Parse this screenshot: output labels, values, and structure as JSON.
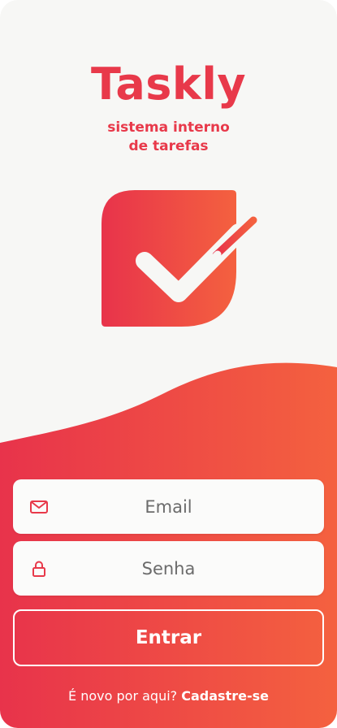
{
  "app": {
    "name": "Taskly",
    "tagline_line1": "sistema interno",
    "tagline_line2": "de tarefas"
  },
  "colors": {
    "brand_red": "#e8394a",
    "brand_orange": "#f4613f",
    "background": "#f7f7f5"
  },
  "login": {
    "email_placeholder": "Email",
    "password_placeholder": "Senha",
    "email_icon": "mail-icon",
    "password_icon": "lock-icon",
    "submit_label": "Entrar"
  },
  "signup": {
    "prompt": "É novo por aqui?",
    "link": "Cadastre-se"
  }
}
